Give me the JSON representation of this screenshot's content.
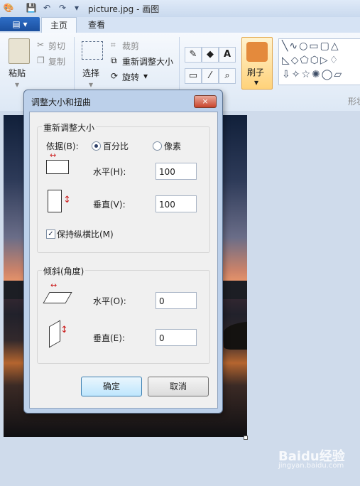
{
  "window": {
    "title": "picture.jpg - 画图"
  },
  "tabs": {
    "file_menu_icon": "menu-icon",
    "home": "主页",
    "view": "查看"
  },
  "ribbon": {
    "paste_label": "粘贴",
    "cut_label": "剪切",
    "copy_label": "复制",
    "select_label": "选择",
    "crop_label": "裁剪",
    "resize_label": "重新调整大小",
    "rotate_label": "旋转",
    "brush_label": "刷子",
    "shapes_label": "形状"
  },
  "dialog": {
    "title": "调整大小和扭曲",
    "close_icon": "×",
    "resize_group": {
      "title": "重新调整大小",
      "basis_label": "依据(B):",
      "percent_label": "百分比",
      "pixels_label": "像素",
      "selected": "percent",
      "horizontal_label": "水平(H):",
      "horizontal_value": "100",
      "vertical_label": "垂直(V):",
      "vertical_value": "100",
      "keep_ratio_label": "保持纵横比(M)",
      "keep_ratio_checked": true
    },
    "skew_group": {
      "title": "倾斜(角度)",
      "horizontal_label": "水平(O):",
      "horizontal_value": "0",
      "vertical_label": "垂直(E):",
      "vertical_value": "0"
    },
    "ok_label": "确定",
    "cancel_label": "取消"
  },
  "watermark": {
    "text": "Baidu经验",
    "sub": "jingyan.baidu.com"
  }
}
